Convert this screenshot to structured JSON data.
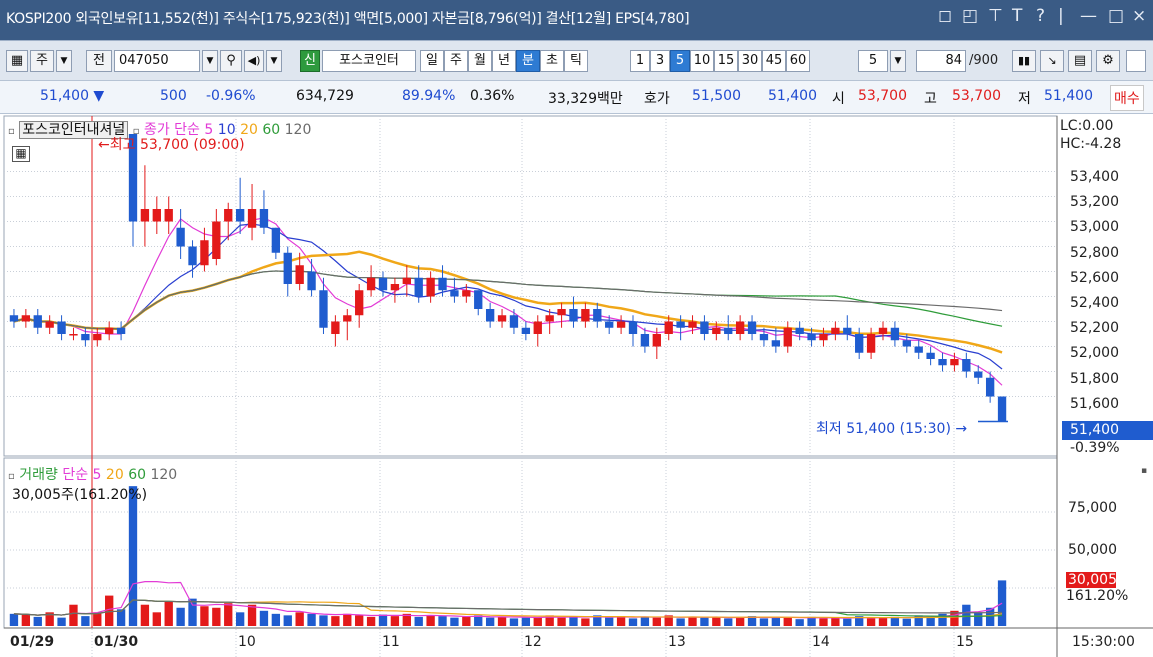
{
  "title": {
    "text": "KOSPI200 외국인보유[11,552(천)] 주식수[175,923(천)] 액면[5,000] 자본금[8,796(억)] 결산[12월] EPS[4,780]",
    "right_glyphs": [
      "◻",
      "◰",
      "⊤",
      "T",
      "?",
      "|",
      "—",
      "□",
      "×"
    ]
  },
  "toolbar": {
    "period_button": "주",
    "jeon_button": "전",
    "code_input": "047050",
    "green_tag": "신",
    "stock_name": "포스코인터",
    "period_tabs": [
      "일",
      "주",
      "월",
      "년",
      "분",
      "초",
      "틱"
    ],
    "active_tab": "분",
    "interval_buttons": [
      "1",
      "3",
      "5",
      "10",
      "15",
      "30",
      "45",
      "60"
    ],
    "active_interval": "5",
    "interval_select": "5",
    "count_value": "84",
    "count_total": "/900"
  },
  "quote": {
    "price": "51,400 ▼",
    "change": "500",
    "change_pct": "-0.96%",
    "volume": "634,729",
    "vol_ratio": "89.94%",
    "turnover": "0.36%",
    "amount": "33,329백만",
    "hoga_label": "호가",
    "ask": "51,500",
    "bid": "51,400",
    "open_label": "시",
    "open": "53,700",
    "high_label": "고",
    "high": "53,700",
    "low_label": "저",
    "low": "51,400",
    "buy_button": "매수"
  },
  "price_panel": {
    "stock_tag": "포스코인터내셔널",
    "ma_label": "종가 단순",
    "ma_periods": [
      "5",
      "10",
      "20",
      "60",
      "120"
    ],
    "high_annotation": "←최고 53,700 (09:00)",
    "low_annotation": "최저 51,400 (15:30) →",
    "lc": "LC:0.00",
    "hc": "HC:-4.28",
    "y_ticks": [
      "53,400",
      "53,200",
      "53,000",
      "52,800",
      "52,600",
      "52,400",
      "52,200",
      "52,000",
      "51,800",
      "51,600"
    ],
    "last_price": "51,400",
    "last_pct": "-0.39%"
  },
  "volume_panel": {
    "label": "거래량",
    "ma_label": "단순",
    "ma_periods": [
      "5",
      "20",
      "60",
      "120"
    ],
    "current": "30,005주(161.20%)",
    "y_ticks": [
      "75,000",
      "50,000"
    ],
    "last_volume": "30,005",
    "last_pct": "161.20%"
  },
  "x_axis": {
    "labels": [
      "01/29",
      "01/30",
      "10",
      "11",
      "12",
      "13",
      "14",
      "15"
    ],
    "time": "15:30:00"
  },
  "colors": {
    "up": "#e31a1a",
    "down": "#1f5ccf",
    "ma5": "#e23bd6",
    "ma10": "#2a3fd0",
    "ma20": "#f0a718",
    "ma60": "#2f9c3a",
    "ma120": "#6b6b6b",
    "title_bg": "#3a5b85"
  },
  "chart_data": {
    "type": "candlestick",
    "ylim": [
      51300,
      53700
    ],
    "candles": [
      {
        "o": 52250,
        "h": 52300,
        "l": 52150,
        "c": 52200
      },
      {
        "o": 52200,
        "h": 52300,
        "l": 52150,
        "c": 52250
      },
      {
        "o": 52250,
        "h": 52300,
        "l": 52100,
        "c": 52150
      },
      {
        "o": 52150,
        "h": 52250,
        "l": 52100,
        "c": 52200
      },
      {
        "o": 52200,
        "h": 52250,
        "l": 52050,
        "c": 52100
      },
      {
        "o": 52100,
        "h": 52150,
        "l": 52050,
        "c": 52100
      },
      {
        "o": 52100,
        "h": 52150,
        "l": 52000,
        "c": 52050
      },
      {
        "o": 52050,
        "h": 52150,
        "l": 52000,
        "c": 52100
      },
      {
        "o": 52100,
        "h": 52200,
        "l": 52050,
        "c": 52150
      },
      {
        "o": 52150,
        "h": 52200,
        "l": 52050,
        "c": 52100
      },
      {
        "o": 53700,
        "h": 53700,
        "l": 52800,
        "c": 53000
      },
      {
        "o": 53000,
        "h": 53450,
        "l": 52800,
        "c": 53100
      },
      {
        "o": 53000,
        "h": 53200,
        "l": 52900,
        "c": 53100
      },
      {
        "o": 53000,
        "h": 53200,
        "l": 52900,
        "c": 53100
      },
      {
        "o": 52950,
        "h": 53100,
        "l": 52700,
        "c": 52800
      },
      {
        "o": 52800,
        "h": 52850,
        "l": 52550,
        "c": 52650
      },
      {
        "o": 52650,
        "h": 52950,
        "l": 52600,
        "c": 52850
      },
      {
        "o": 52700,
        "h": 53100,
        "l": 52650,
        "c": 53000
      },
      {
        "o": 53000,
        "h": 53150,
        "l": 52850,
        "c": 53100
      },
      {
        "o": 53100,
        "h": 53350,
        "l": 52900,
        "c": 53000
      },
      {
        "o": 52950,
        "h": 53300,
        "l": 52850,
        "c": 53100
      },
      {
        "o": 53100,
        "h": 53250,
        "l": 52900,
        "c": 52950
      },
      {
        "o": 52950,
        "h": 52950,
        "l": 52700,
        "c": 52750
      },
      {
        "o": 52750,
        "h": 52800,
        "l": 52400,
        "c": 52500
      },
      {
        "o": 52500,
        "h": 52750,
        "l": 52450,
        "c": 52650
      },
      {
        "o": 52600,
        "h": 52700,
        "l": 52400,
        "c": 52450
      },
      {
        "o": 52450,
        "h": 52550,
        "l": 52100,
        "c": 52150
      },
      {
        "o": 52100,
        "h": 52250,
        "l": 52000,
        "c": 52200
      },
      {
        "o": 52200,
        "h": 52300,
        "l": 52050,
        "c": 52250
      },
      {
        "o": 52250,
        "h": 52500,
        "l": 52150,
        "c": 52450
      },
      {
        "o": 52450,
        "h": 52650,
        "l": 52400,
        "c": 52550
      },
      {
        "o": 52550,
        "h": 52600,
        "l": 52400,
        "c": 52450
      },
      {
        "o": 52450,
        "h": 52550,
        "l": 52350,
        "c": 52500
      },
      {
        "o": 52500,
        "h": 52650,
        "l": 52400,
        "c": 52550
      },
      {
        "o": 52550,
        "h": 52650,
        "l": 52350,
        "c": 52400
      },
      {
        "o": 52400,
        "h": 52600,
        "l": 52350,
        "c": 52550
      },
      {
        "o": 52550,
        "h": 52650,
        "l": 52400,
        "c": 52450
      },
      {
        "o": 52450,
        "h": 52550,
        "l": 52350,
        "c": 52400
      },
      {
        "o": 52400,
        "h": 52500,
        "l": 52350,
        "c": 52450
      },
      {
        "o": 52450,
        "h": 52450,
        "l": 52250,
        "c": 52300
      },
      {
        "o": 52300,
        "h": 52350,
        "l": 52150,
        "c": 52200
      },
      {
        "o": 52200,
        "h": 52300,
        "l": 52150,
        "c": 52250
      },
      {
        "o": 52250,
        "h": 52300,
        "l": 52100,
        "c": 52150
      },
      {
        "o": 52150,
        "h": 52200,
        "l": 52050,
        "c": 52100
      },
      {
        "o": 52100,
        "h": 52250,
        "l": 52000,
        "c": 52200
      },
      {
        "o": 52200,
        "h": 52300,
        "l": 52100,
        "c": 52250
      },
      {
        "o": 52250,
        "h": 52350,
        "l": 52150,
        "c": 52300
      },
      {
        "o": 52300,
        "h": 52400,
        "l": 52150,
        "c": 52200
      },
      {
        "o": 52200,
        "h": 52350,
        "l": 52150,
        "c": 52300
      },
      {
        "o": 52300,
        "h": 52350,
        "l": 52150,
        "c": 52200
      },
      {
        "o": 52200,
        "h": 52250,
        "l": 52100,
        "c": 52150
      },
      {
        "o": 52150,
        "h": 52250,
        "l": 52100,
        "c": 52200
      },
      {
        "o": 52200,
        "h": 52250,
        "l": 52000,
        "c": 52100
      },
      {
        "o": 52100,
        "h": 52150,
        "l": 51950,
        "c": 52000
      },
      {
        "o": 52000,
        "h": 52150,
        "l": 51900,
        "c": 52100
      },
      {
        "o": 52100,
        "h": 52250,
        "l": 52050,
        "c": 52200
      },
      {
        "o": 52200,
        "h": 52250,
        "l": 52050,
        "c": 52150
      },
      {
        "o": 52150,
        "h": 52250,
        "l": 52100,
        "c": 52200
      },
      {
        "o": 52200,
        "h": 52250,
        "l": 52050,
        "c": 52100
      },
      {
        "o": 52100,
        "h": 52200,
        "l": 52050,
        "c": 52150
      },
      {
        "o": 52150,
        "h": 52250,
        "l": 52050,
        "c": 52100
      },
      {
        "o": 52100,
        "h": 52250,
        "l": 52050,
        "c": 52200
      },
      {
        "o": 52200,
        "h": 52250,
        "l": 52050,
        "c": 52100
      },
      {
        "o": 52100,
        "h": 52150,
        "l": 52000,
        "c": 52050
      },
      {
        "o": 52050,
        "h": 52150,
        "l": 51950,
        "c": 52000
      },
      {
        "o": 52000,
        "h": 52200,
        "l": 51950,
        "c": 52150
      },
      {
        "o": 52150,
        "h": 52200,
        "l": 52050,
        "c": 52100
      },
      {
        "o": 52100,
        "h": 52150,
        "l": 52000,
        "c": 52050
      },
      {
        "o": 52050,
        "h": 52150,
        "l": 52000,
        "c": 52100
      },
      {
        "o": 52100,
        "h": 52200,
        "l": 52050,
        "c": 52150
      },
      {
        "o": 52150,
        "h": 52250,
        "l": 52050,
        "c": 52100
      },
      {
        "o": 52100,
        "h": 52150,
        "l": 51900,
        "c": 51950
      },
      {
        "o": 51950,
        "h": 52150,
        "l": 51900,
        "c": 52100
      },
      {
        "o": 52100,
        "h": 52200,
        "l": 52050,
        "c": 52150
      },
      {
        "o": 52150,
        "h": 52200,
        "l": 52000,
        "c": 52050
      },
      {
        "o": 52050,
        "h": 52100,
        "l": 51950,
        "c": 52000
      },
      {
        "o": 52000,
        "h": 52050,
        "l": 51900,
        "c": 51950
      },
      {
        "o": 51950,
        "h": 52000,
        "l": 51850,
        "c": 51900
      },
      {
        "o": 51900,
        "h": 51950,
        "l": 51800,
        "c": 51850
      },
      {
        "o": 51850,
        "h": 51950,
        "l": 51800,
        "c": 51900
      },
      {
        "o": 51900,
        "h": 51950,
        "l": 51750,
        "c": 51800
      },
      {
        "o": 51800,
        "h": 51850,
        "l": 51700,
        "c": 51750
      },
      {
        "o": 51750,
        "h": 51800,
        "l": 51550,
        "c": 51600
      },
      {
        "o": 51600,
        "h": 51600,
        "l": 51400,
        "c": 51400
      }
    ],
    "volumes": [
      8000,
      7500,
      6000,
      9000,
      5500,
      14000,
      6500,
      9000,
      20000,
      11000,
      92000,
      14000,
      9000,
      16000,
      12000,
      18000,
      13000,
      12000,
      15000,
      9000,
      14000,
      10000,
      8000,
      7000,
      9000,
      8000,
      7000,
      6500,
      8000,
      7000,
      6000,
      7500,
      6500,
      8000,
      6000,
      7000,
      6500,
      5500,
      6000,
      7000,
      5500,
      6000,
      5000,
      5500,
      6000,
      7000,
      5500,
      6000,
      5000,
      7000,
      5500,
      6500,
      5000,
      6000,
      5500,
      7000,
      5000,
      6000,
      5500,
      6000,
      5000,
      5500,
      6500,
      5000,
      6000,
      5500,
      4500,
      6000,
      5000,
      5500,
      4800,
      6500,
      5000,
      5500,
      6000,
      4800,
      7000,
      6000,
      8000,
      10000,
      14000,
      9000,
      12000,
      30005
    ],
    "xlabels": [
      "01/29",
      "01/30",
      "10",
      "11",
      "12",
      "13",
      "14",
      "15"
    ]
  }
}
